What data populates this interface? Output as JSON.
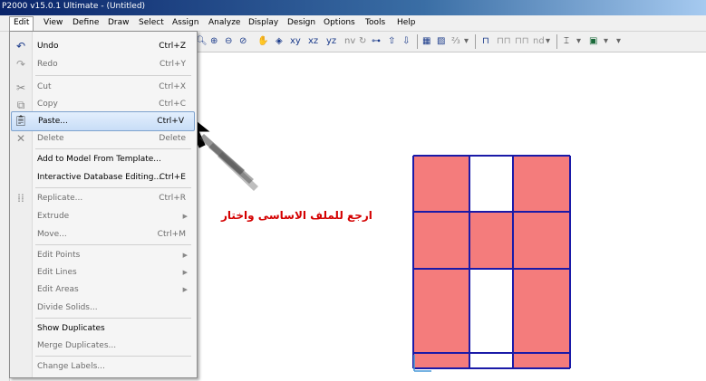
{
  "window": {
    "title": "P2000 v15.0.1 Ultimate  - (Untitled)"
  },
  "menubar": [
    "Edit",
    "View",
    "Define",
    "Draw",
    "Select",
    "Assign",
    "Analyze",
    "Display",
    "Design",
    "Options",
    "Tools",
    "Help"
  ],
  "toolbar": {
    "views": [
      "xy",
      "xz",
      "yz",
      "nv"
    ],
    "nd_label": "nd"
  },
  "edit_menu": {
    "undo": {
      "label": "Undo",
      "shortcut": "Ctrl+Z"
    },
    "redo": {
      "label": "Redo",
      "shortcut": "Ctrl+Y"
    },
    "cut": {
      "label": "Cut",
      "shortcut": "Ctrl+X"
    },
    "copy": {
      "label": "Copy",
      "shortcut": "Ctrl+C"
    },
    "paste": {
      "label": "Paste...",
      "shortcut": "Ctrl+V"
    },
    "delete": {
      "label": "Delete",
      "shortcut": "Delete"
    },
    "add_template": {
      "label": "Add to Model From Template..."
    },
    "interactive_db": {
      "label": "Interactive Database Editing...",
      "shortcut": "Ctrl+E"
    },
    "replicate": {
      "label": "Replicate...",
      "shortcut": "Ctrl+R"
    },
    "extrude": {
      "label": "Extrude"
    },
    "move": {
      "label": "Move...",
      "shortcut": "Ctrl+M"
    },
    "edit_points": {
      "label": "Edit Points"
    },
    "edit_lines": {
      "label": "Edit Lines"
    },
    "edit_areas": {
      "label": "Edit Areas"
    },
    "divide_solids": {
      "label": "Divide Solids..."
    },
    "show_duplicates": {
      "label": "Show Duplicates"
    },
    "merge_duplicates": {
      "label": "Merge Duplicates..."
    },
    "change_labels": {
      "label": "Change Labels..."
    }
  },
  "annotation": {
    "text": "ارجع للملف الاساسى واختار",
    "color": "#d40000"
  },
  "model": {
    "fill_color": "#f47c7c",
    "line_color": "#1a1aa8"
  }
}
